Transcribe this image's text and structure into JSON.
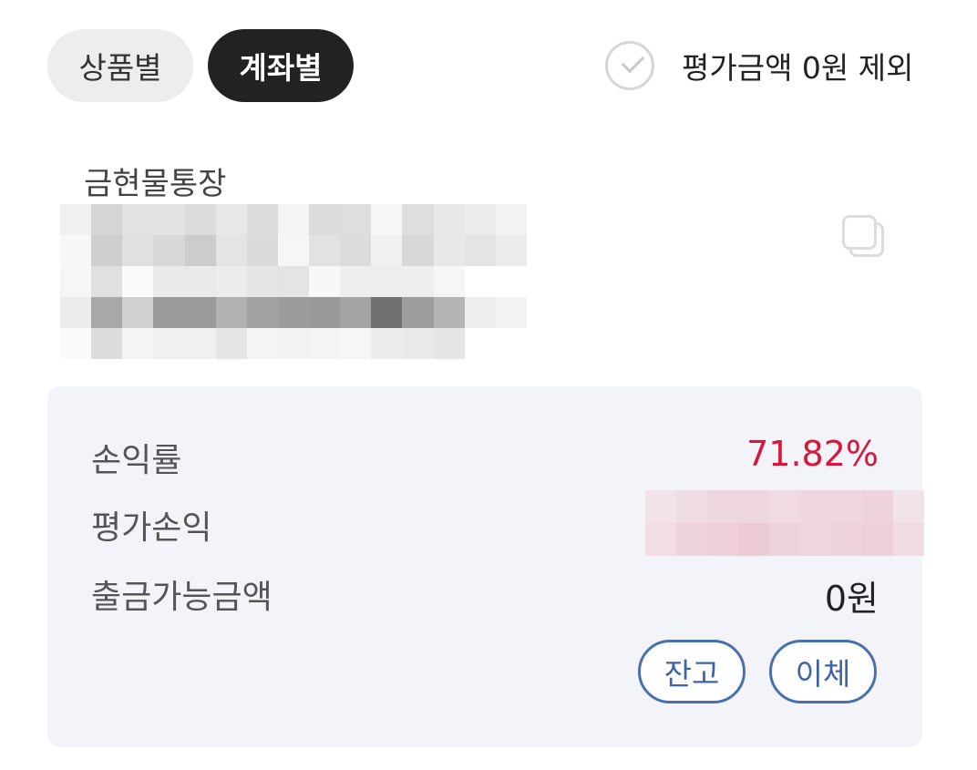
{
  "tabs": {
    "by_product": "상품별",
    "by_account": "계좌별",
    "selected": "by_account"
  },
  "filter": {
    "exclude_zero_label": "평가금액 0원 제외",
    "exclude_zero_checked": false
  },
  "account": {
    "name": "금현물통장",
    "number_masked": true
  },
  "summary": {
    "return_rate_label": "손익률",
    "return_rate_value": "71.82%",
    "eval_pl_label": "평가손익",
    "eval_pl_masked": true,
    "withdrawable_label": "출금가능금액",
    "withdrawable_value": "0원"
  },
  "actions": {
    "balance_label": "잔고",
    "transfer_label": "이체"
  },
  "colors": {
    "accent_dark": "#222222",
    "positive_red": "#d8173a",
    "button_blue": "#4a6fb0",
    "card_bg": "#f3f4fa"
  }
}
